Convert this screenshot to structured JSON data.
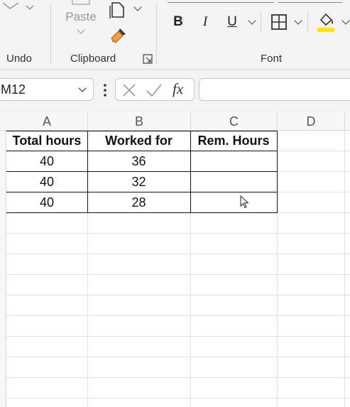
{
  "ribbon": {
    "undo_label": "Undo",
    "clipboard_label": "Clipboard",
    "paste_label": "Paste",
    "font_label": "Font",
    "bold": "B",
    "italic": "I",
    "underline": "U",
    "fill_color": "#ffe600"
  },
  "formula_bar": {
    "name_box": "M12",
    "formula_value": ""
  },
  "columns": [
    "A",
    "B",
    "C",
    "D"
  ],
  "table": {
    "headers": [
      "Total hours",
      "Worked for",
      "Rem. Hours"
    ],
    "rows": [
      [
        "40",
        "36",
        ""
      ],
      [
        "40",
        "32",
        ""
      ],
      [
        "40",
        "28",
        ""
      ]
    ]
  }
}
